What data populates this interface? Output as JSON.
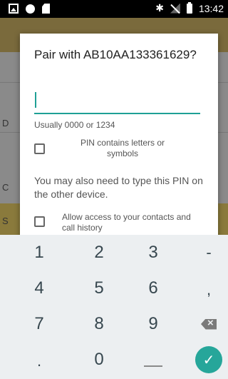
{
  "status_bar": {
    "time": "13:42",
    "bt_glyph": "✱"
  },
  "background": {
    "label_d": "D",
    "label_c": "C",
    "label_s": "S"
  },
  "dialog": {
    "title": "Pair with AB10AA133361629?",
    "pin_value": "",
    "hint": "Usually 0000 or 1234",
    "checkbox_letters": "PIN contains letters or symbols",
    "note": "You may also need to type this PIN on the other device.",
    "checkbox_access": "Allow access to your contacts and call history"
  },
  "keyboard": {
    "keys": [
      "1",
      "2",
      "3",
      "-",
      "4",
      "5",
      "6",
      ",",
      "7",
      "8",
      "9",
      "0",
      "."
    ],
    "enter_glyph": "✓"
  },
  "colors": {
    "accent": "#1fa095",
    "enter": "#26a69a"
  }
}
